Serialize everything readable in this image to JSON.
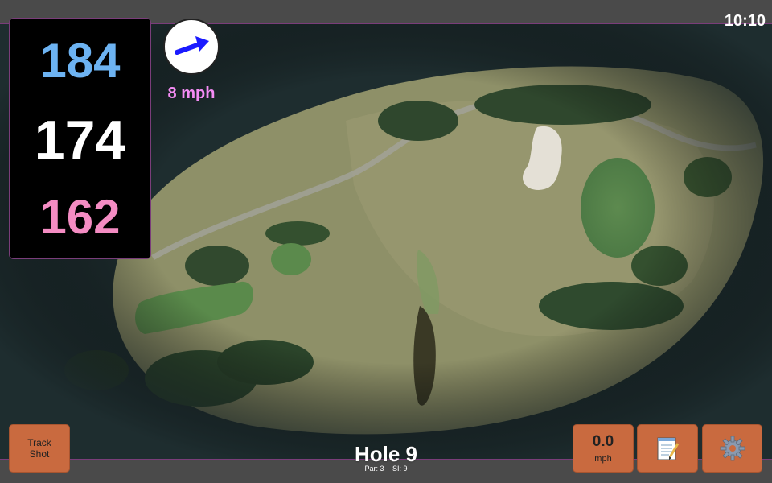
{
  "status": {
    "clock": "10:10"
  },
  "distances": {
    "back": "184",
    "middle": "174",
    "front": "162"
  },
  "wind": {
    "speed": "8 mph",
    "direction_icon": "wind-arrow-icon"
  },
  "hole": {
    "title": "Hole 9",
    "par": "Par: 3",
    "si": "SI: 9"
  },
  "buttons": {
    "track_shot_line1": "Track",
    "track_shot_line2": "Shot",
    "speed_value": "0.0",
    "speed_unit": "mph",
    "notes_icon": "notepad-icon",
    "settings_icon": "gear-icon"
  },
  "colors": {
    "back": "#6db3f2",
    "middle": "#ffffff",
    "front": "#f48cc3",
    "wind_text": "#f48cf4",
    "button": "#c96a3f",
    "accent_border": "#7a3d7a"
  }
}
